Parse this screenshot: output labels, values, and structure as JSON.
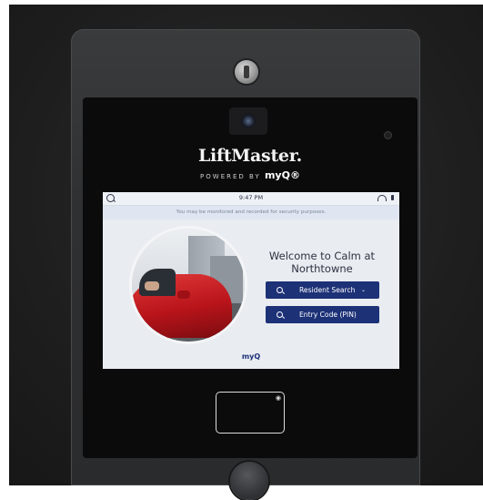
{
  "device": {
    "brand": "LiftMaster.",
    "powered_by": "POWERED BY",
    "powered_logo": "myQ®"
  },
  "screen": {
    "status_time": "9:47 PM",
    "notice": "You may be monitored and recorded for security purposes.",
    "welcome_line1": "Welcome to Calm at",
    "welcome_line2": "Northtowne",
    "resident_search_label": "Resident Search",
    "resident_search_caret": "⌄",
    "entry_code_label": "Entry Code (PIN)",
    "footer_logo": "myQ"
  },
  "colors": {
    "button_bg": "#1d3177",
    "screen_bg": "#e9ecf1",
    "notice_bg": "#dfe6f1"
  },
  "icons": {
    "search": "search-icon",
    "wifi": "wifi-icon",
    "lock": "key-lock-icon",
    "camera": "camera-icon",
    "nfc": "nfc-icon"
  }
}
